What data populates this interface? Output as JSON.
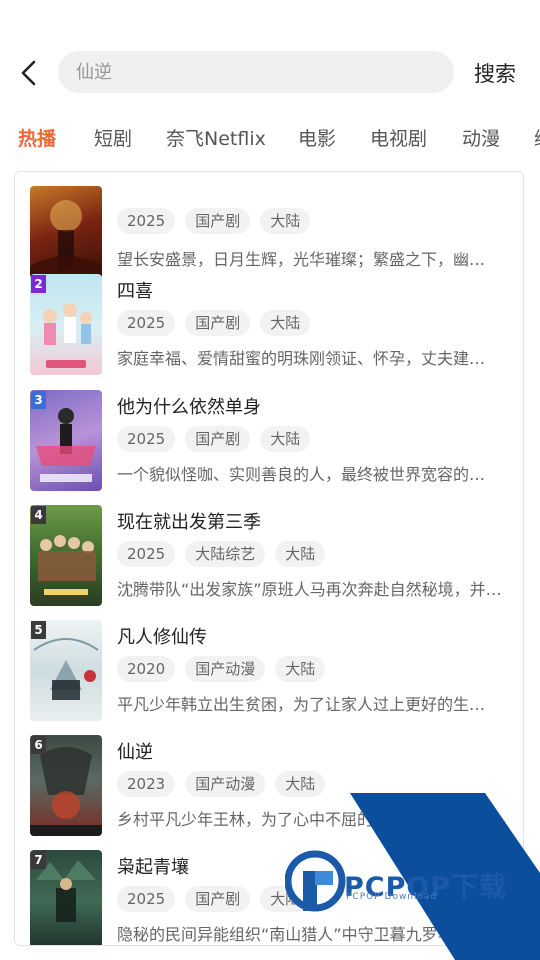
{
  "search": {
    "placeholder": "仙逆",
    "button_label": "搜索"
  },
  "tabs": [
    {
      "label": "热播",
      "active": true
    },
    {
      "label": "短剧"
    },
    {
      "label": "奈飞Netflix"
    },
    {
      "label": "电影"
    },
    {
      "label": "电视剧"
    },
    {
      "label": "动漫"
    },
    {
      "label": "综"
    }
  ],
  "colors": {
    "accent": "#f0683a",
    "tag_bg": "#f2f2f2",
    "rank_purple": "#7a2bd6",
    "rank_blue": "#3a6fd8",
    "rank_dark": "#3a3a3a"
  },
  "items": [
    {
      "rank": "",
      "title": "",
      "tags": [
        "2025",
        "国产剧",
        "大陆"
      ],
      "desc": "望长安盛景，日月生辉，光华璀璨；繁盛之下，幽…",
      "rank_color": ""
    },
    {
      "rank": "2",
      "title": "四喜",
      "tags": [
        "2025",
        "国产剧",
        "大陆"
      ],
      "desc": "家庭幸福、爱情甜蜜的明珠刚领证、怀孕，丈夫建…",
      "rank_color": "#7a2bd6"
    },
    {
      "rank": "3",
      "title": "他为什么依然单身",
      "tags": [
        "2025",
        "国产剧",
        "大陆"
      ],
      "desc": "一个貌似怪咖、实则善良的人，最终被世界宽容的…",
      "rank_color": "#3a6fd8"
    },
    {
      "rank": "4",
      "title": "现在就出发第三季",
      "tags": [
        "2025",
        "大陆综艺",
        "大陆"
      ],
      "desc": "沈腾带队“出发家族”原班人马再次奔赴自然秘境，并…",
      "rank_color": "#3a3a3a"
    },
    {
      "rank": "5",
      "title": "凡人修仙传",
      "tags": [
        "2020",
        "国产动漫",
        "大陆"
      ],
      "desc": "平凡少年韩立出生贫困，为了让家人过上更好的生…",
      "rank_color": "#3a3a3a"
    },
    {
      "rank": "6",
      "title": "仙逆",
      "tags": [
        "2023",
        "国产动漫",
        "大陆"
      ],
      "desc": "乡村平凡少年王林，为了心中不屈的…",
      "rank_color": "#3a3a3a"
    },
    {
      "rank": "7",
      "title": "枭起青壤",
      "tags": [
        "2025",
        "国产剧",
        "大陆"
      ],
      "desc": "隐秘的民间异能组织“南山猎人”中守卫暮九罗与…",
      "rank_color": "#3a3a3a"
    }
  ],
  "watermark": {
    "brand": "PCPOP下载",
    "sub": "PCPOP Download"
  }
}
